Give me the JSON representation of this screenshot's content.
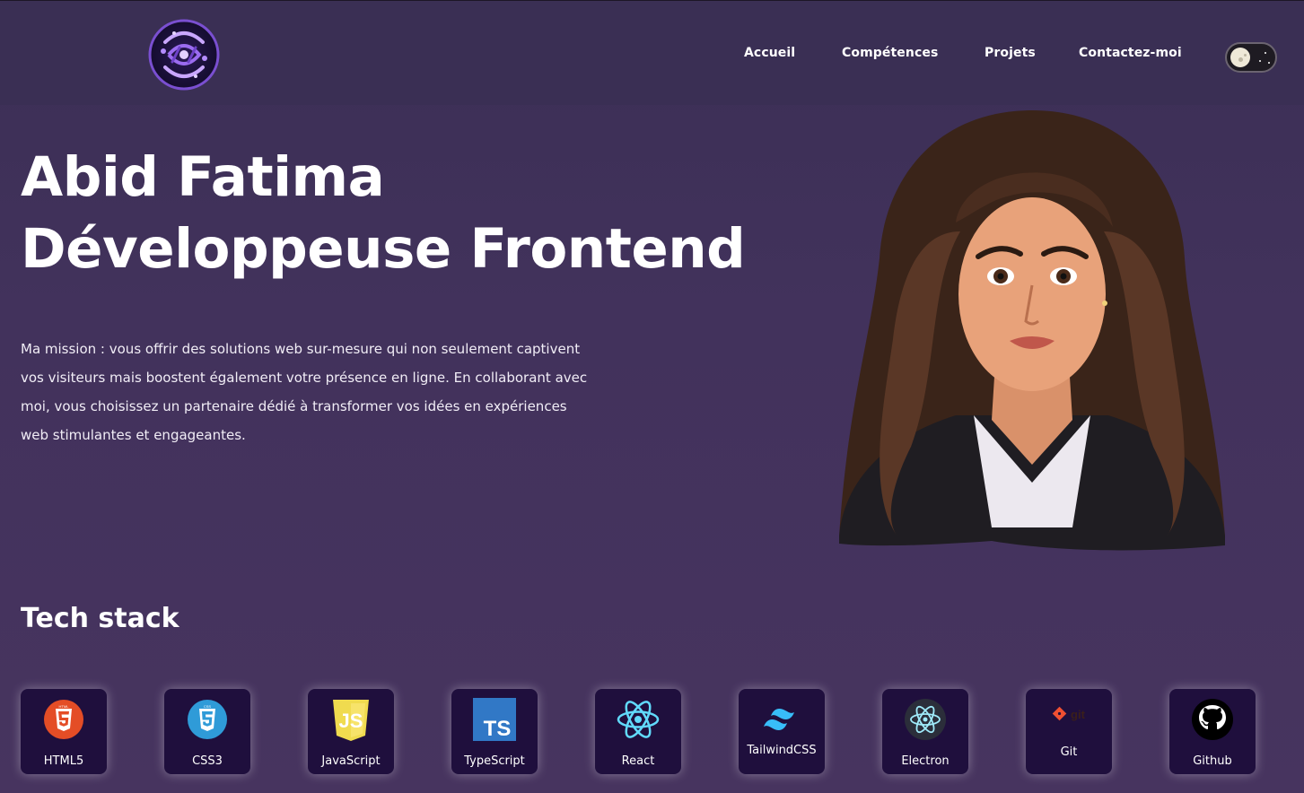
{
  "nav": {
    "items": [
      "Accueil",
      "Compétences",
      "Projets",
      "Contactez-moi"
    ]
  },
  "hero": {
    "name": "Abid Fatima",
    "role": "Développeuse Frontend",
    "mission": "Ma mission : vous offrir des solutions web sur-mesure qui non seulement captivent vos visiteurs mais boostent également votre présence en ligne. En collaborant avec moi, vous choisissez un partenaire dédié à transformer vos idées en expériences web stimulantes et engageantes."
  },
  "tech_stack": {
    "title": "Tech stack",
    "items": [
      {
        "label": "HTML5",
        "icon": "html5-icon",
        "color": "#e44d26"
      },
      {
        "label": "CSS3",
        "icon": "css3-icon",
        "color": "#2965f1"
      },
      {
        "label": "JavaScript",
        "icon": "javascript-icon",
        "color": "#f0db4f"
      },
      {
        "label": "TypeScript",
        "icon": "typescript-icon",
        "color": "#3178c6"
      },
      {
        "label": "React",
        "icon": "react-icon",
        "color": "#61dafb"
      },
      {
        "label": "TailwindCSS",
        "icon": "tailwindcss-icon",
        "color": "#38bdf8"
      },
      {
        "label": "Electron",
        "icon": "electron-icon",
        "color": "#47848f"
      },
      {
        "label": "Git",
        "icon": "git-icon",
        "color": "#f05032"
      },
      {
        "label": "Github",
        "icon": "github-icon",
        "color": "#ffffff"
      }
    ]
  },
  "colors": {
    "background": "#42325c",
    "header": "#3a2f54",
    "tile": "#1f0f3d"
  }
}
